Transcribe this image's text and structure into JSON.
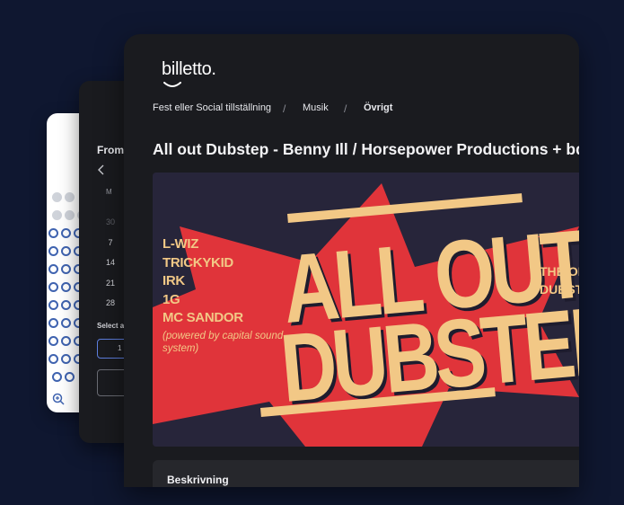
{
  "event_page": {
    "logo": "billetto.",
    "breadcrumb": [
      "Fest eller Social tillställning",
      "Musik",
      "Övrigt"
    ],
    "breadcrumb_separator": "/",
    "title": "All out Dubstep - Benny Ill / Horsepower Productions + bda",
    "poster": {
      "lineup": [
        "L-WIZ",
        "TRICKYKID",
        "IRK",
        "1G",
        "MC SANDOR"
      ],
      "lineup_note": "(powered by capital sound system)",
      "headline_line1": "ALL OUT",
      "headline_line2": "DUBSTEP",
      "side_text": [
        "THE OR",
        "DUBST"
      ]
    },
    "description_heading": "Beskrivning"
  },
  "date_picker": {
    "from_label": "From",
    "prev_icon": "chevron-left-icon",
    "weekday_header": "M",
    "days": [
      "30",
      "7",
      "14",
      "21",
      "28"
    ],
    "select_label": "Select a",
    "input_value": "1"
  },
  "seat_map": {
    "zoom_icon": "zoom-in-icon"
  },
  "colors": {
    "background": "#0f1730",
    "card": "#1a1b1f",
    "poster_accent_red": "#e0343a",
    "poster_cream": "#f2c886",
    "seat_outline": "#3f63b0"
  }
}
